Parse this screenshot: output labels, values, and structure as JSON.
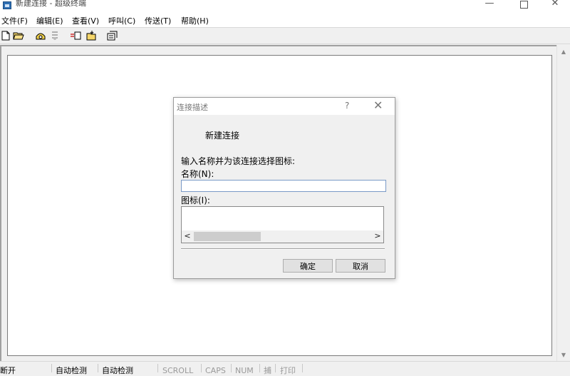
{
  "window": {
    "title": "新建连接 - 超级终端",
    "min_glyph": "—",
    "close_glyph": "✕"
  },
  "menu": [
    "文件(F)",
    "编辑(E)",
    "查看(V)",
    "呼叫(C)",
    "传送(T)",
    "帮助(H)"
  ],
  "toolbar": {
    "icons": [
      "new-icon",
      "open-icon",
      "call-icon",
      "disconnect-icon",
      "send-icon",
      "receive-icon",
      "properties-icon"
    ]
  },
  "status": {
    "connection": "断开",
    "detect1": "自动检测",
    "detect2": "自动检测",
    "scroll": "SCROLL",
    "caps": "CAPS",
    "num": "NUM",
    "capture": "捕",
    "print": "打印"
  },
  "dialog": {
    "title": "连接描述",
    "help": "?",
    "close": "✕",
    "connection_name": "新建连接",
    "prompt": "输入名称并为该连接选择图标:",
    "name_label": "名称(N):",
    "name_value": "",
    "icon_label": "图标(I):",
    "scroll_left": "<",
    "scroll_right": ">",
    "ok": "确定",
    "cancel": "取消"
  },
  "colors": {
    "input_border": "#7a9ac7",
    "window_bg": "#f0f0f0"
  }
}
